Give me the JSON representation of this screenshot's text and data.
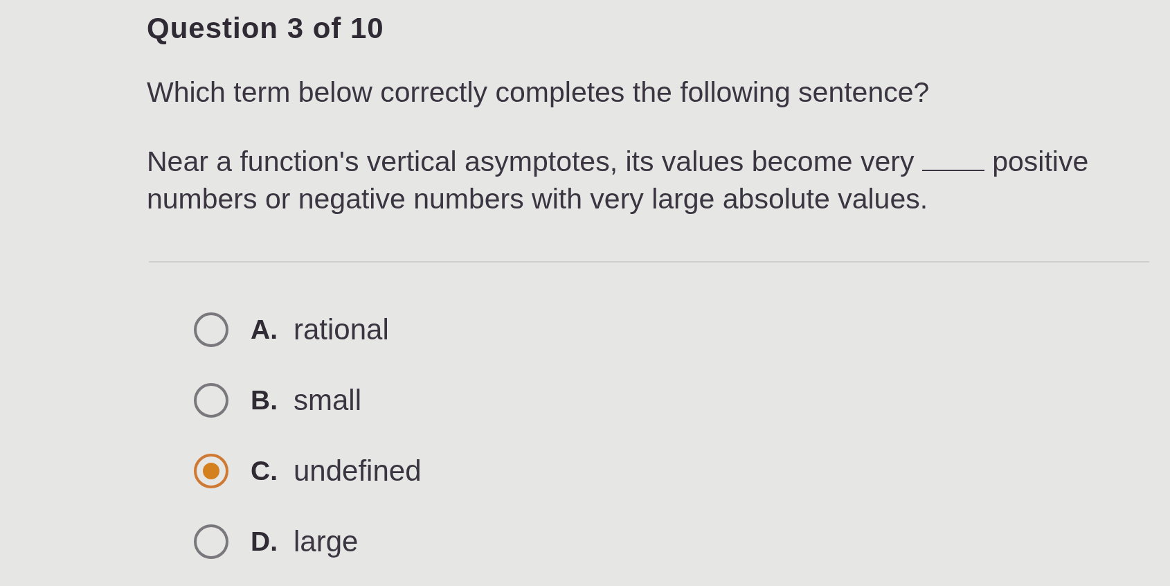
{
  "title": "Question 3 of 10",
  "question": "Which term below correctly completes the following sentence?",
  "sentence": {
    "before": "Near a function's vertical asymptotes, its values become very",
    "after": "positive numbers or negative numbers with very large absolute values."
  },
  "options": [
    {
      "letter": "A.",
      "text": "rational",
      "selected": false
    },
    {
      "letter": "B.",
      "text": "small",
      "selected": false
    },
    {
      "letter": "C.",
      "text": "undefined",
      "selected": true
    },
    {
      "letter": "D.",
      "text": "large",
      "selected": false
    }
  ]
}
